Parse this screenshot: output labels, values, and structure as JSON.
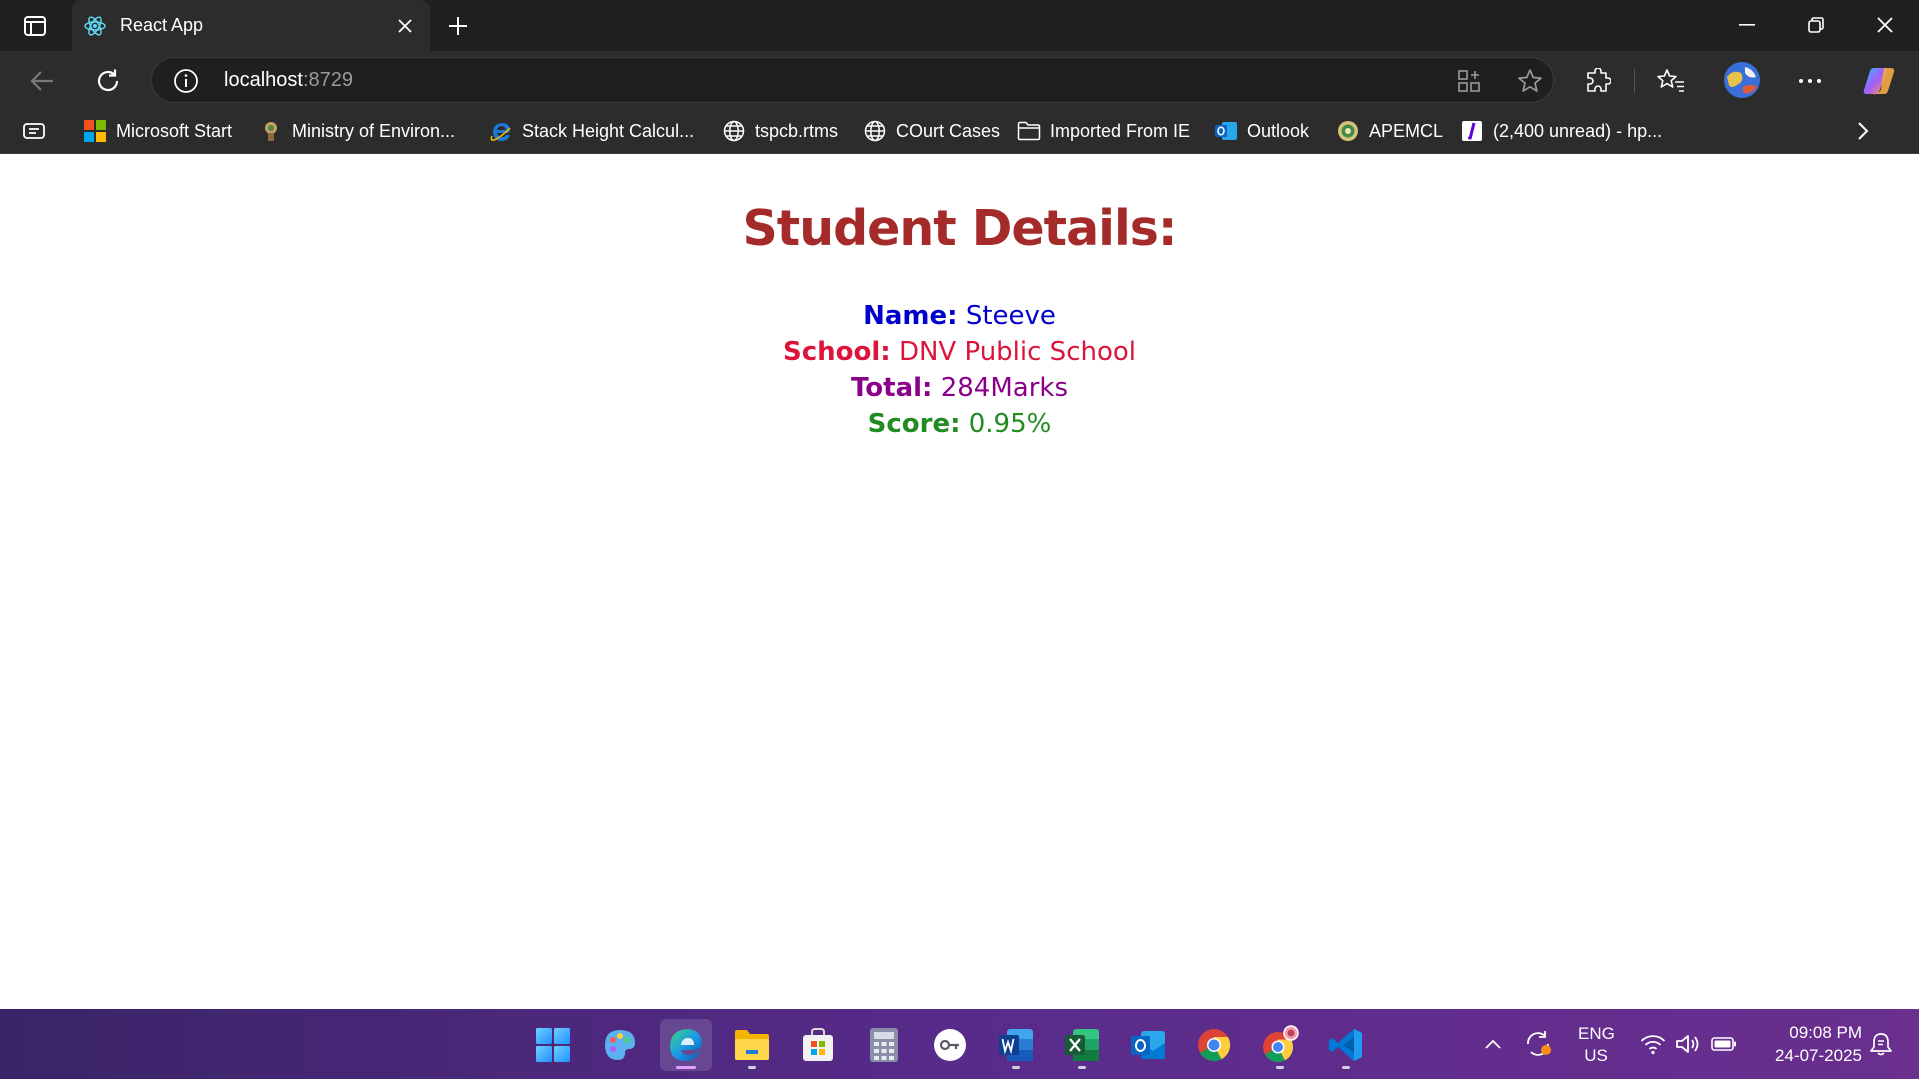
{
  "browser": {
    "tab": {
      "title": "React App"
    },
    "address": {
      "host": "localhost",
      "port": ":8729"
    },
    "bookmarks": [
      {
        "label": "Microsoft Start",
        "icon": "microsoft-logo-icon"
      },
      {
        "label": "Ministry of Environ...",
        "icon": "emblem-icon"
      },
      {
        "label": "Stack Height Calcul...",
        "icon": "ie-icon"
      },
      {
        "label": "tspcb.rtms",
        "icon": "globe-icon"
      },
      {
        "label": "COurt Cases",
        "icon": "globe-icon"
      },
      {
        "label": "Imported From IE",
        "icon": "folder-icon"
      },
      {
        "label": "Outlook",
        "icon": "outlook-icon"
      },
      {
        "label": "APEMCL",
        "icon": "seal-icon"
      },
      {
        "label": "(2,400 unread) - hp...",
        "icon": "yahoo-mail-icon"
      }
    ]
  },
  "page": {
    "title": "Student Details:",
    "details": [
      {
        "label": "Name:",
        "value": "Steeve",
        "color": "#0000cd"
      },
      {
        "label": "School:",
        "value": "DNV Public School",
        "color": "#dc143c"
      },
      {
        "label": "Total:",
        "value": "284Marks",
        "color": "#8b008b"
      },
      {
        "label": "Score:",
        "value": "0.95%",
        "color": "#228b22"
      }
    ]
  },
  "taskbar": {
    "apps": [
      "windows-start-icon",
      "paint-icon",
      "edge-icon",
      "file-explorer-icon",
      "microsoft-store-icon",
      "calculator-icon",
      "key-app-icon",
      "word-icon",
      "excel-icon",
      "outlook-icon",
      "chrome-icon",
      "chrome-profile-icon",
      "vscode-icon"
    ],
    "language": {
      "line1": "ENG",
      "line2": "US"
    },
    "clock": {
      "time": "09:08 PM",
      "date": "24-07-2025"
    }
  },
  "colors": {
    "title": "#a52a2a",
    "chrome_dark": "#202020",
    "chrome": "#2c2c2c",
    "taskbar_start": "#3a2468",
    "taskbar_end": "#6a2f8f"
  }
}
